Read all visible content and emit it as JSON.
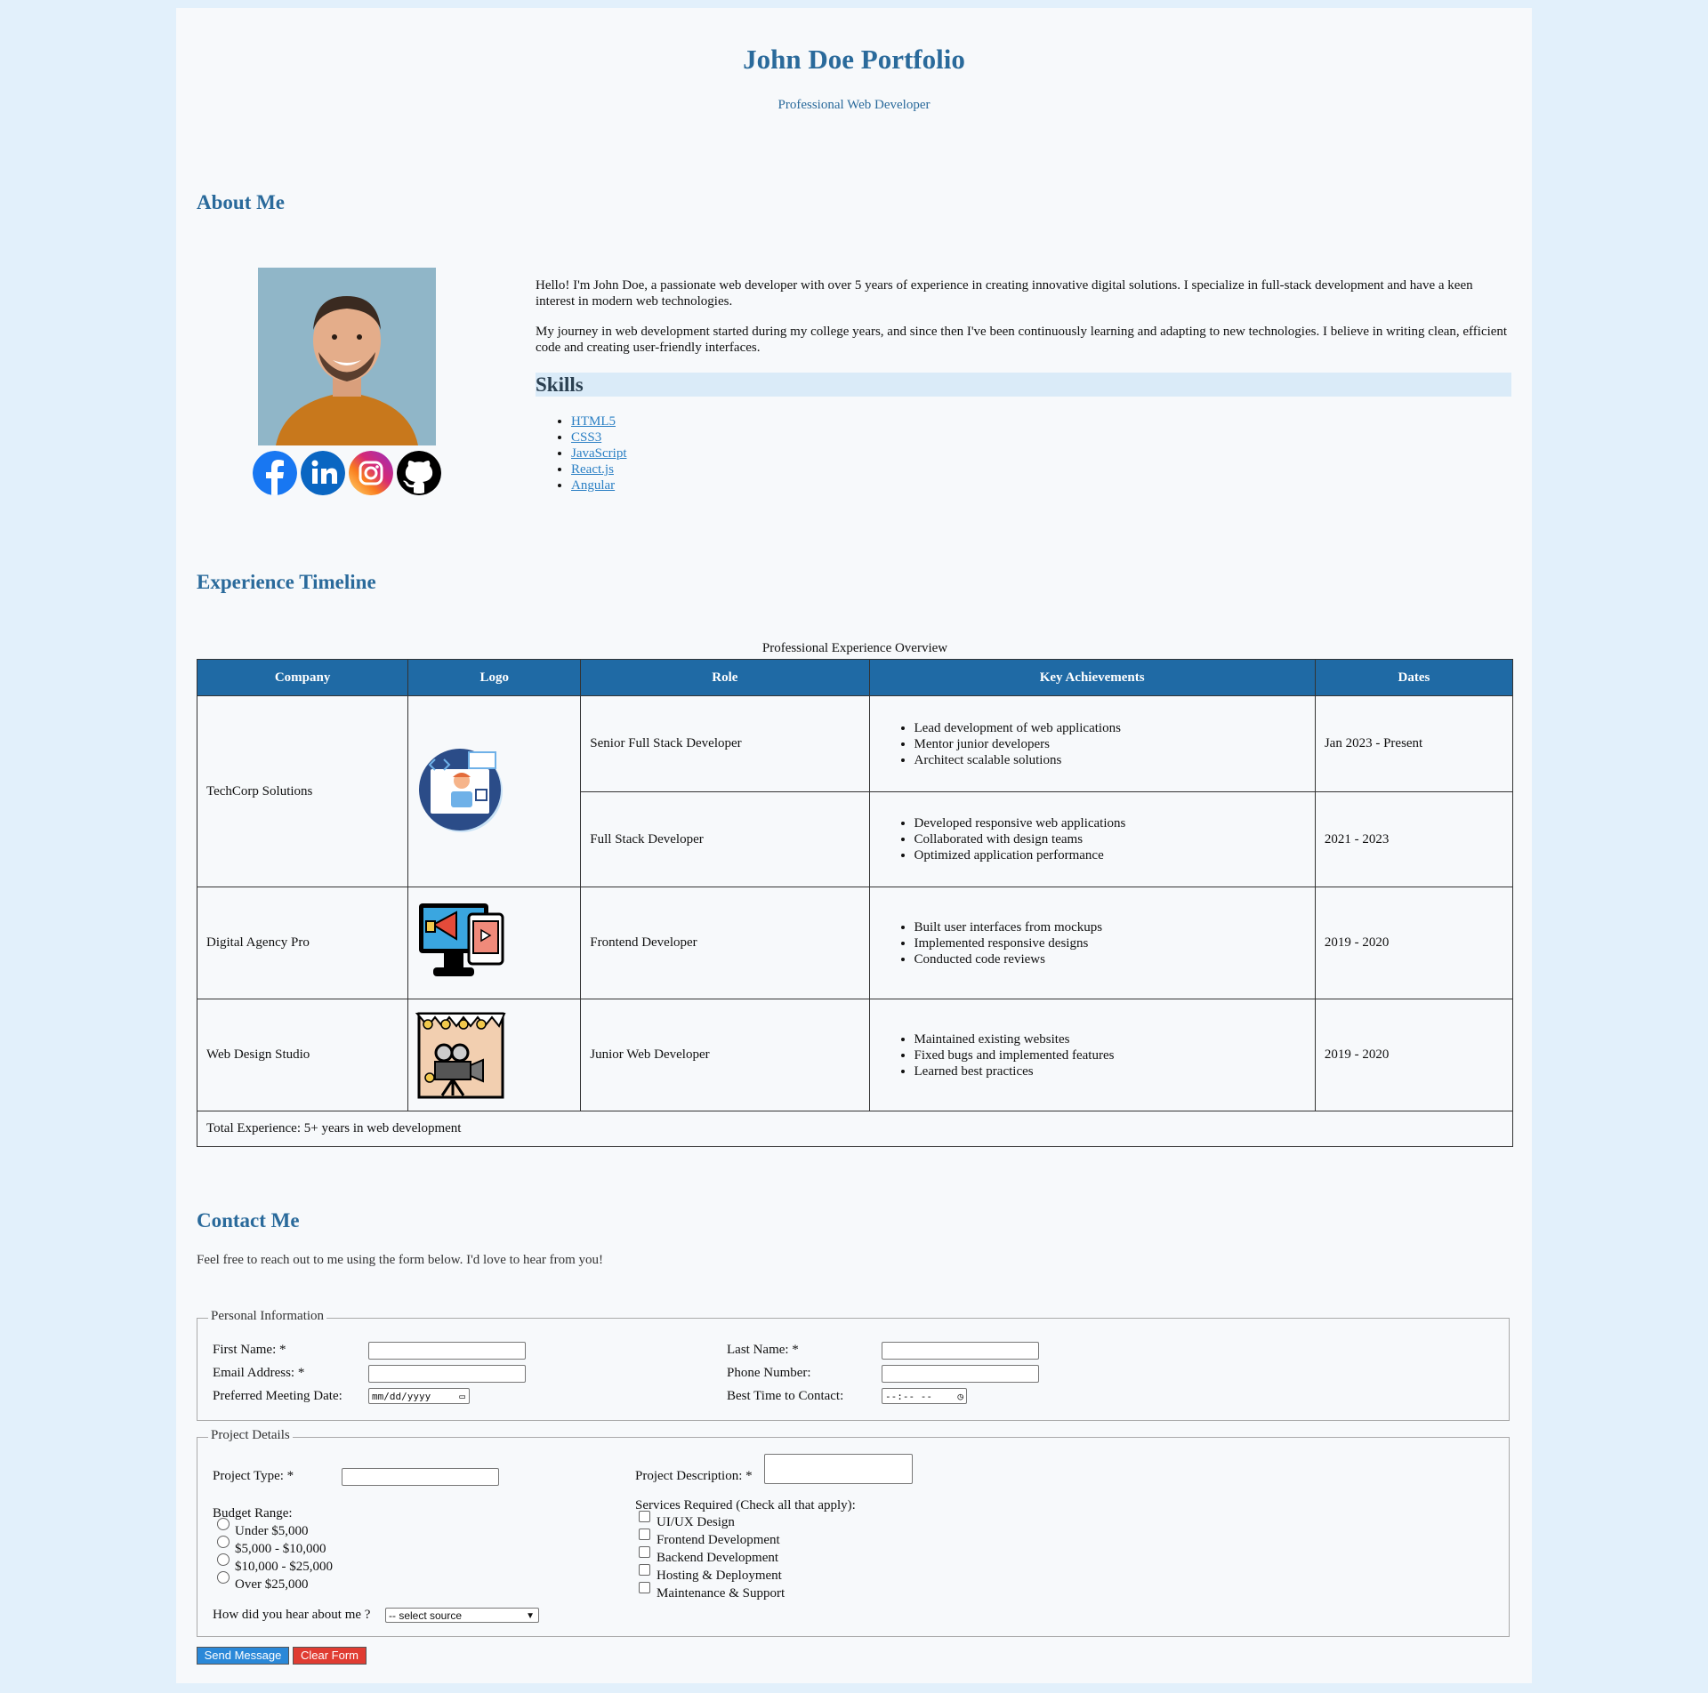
{
  "header": {
    "title": "John Doe Portfolio",
    "subtitle": "Professional Web Developer"
  },
  "about": {
    "heading": "About Me",
    "paragraph1": "Hello! I'm John Doe, a passionate web developer with over 5 years of experience in creating innovative digital solutions. I specialize in full-stack development and have a keen interest in modern web technologies.",
    "paragraph2": "My journey in web development started during my college years, and since then I've been continuously learning and adapting to new technologies. I believe in writing clean, efficient code and creating user-friendly interfaces.",
    "social": [
      "facebook-icon",
      "linkedin-icon",
      "instagram-icon",
      "github-icon"
    ]
  },
  "skills": {
    "heading": "Skills",
    "items": [
      "HTML5",
      "CSS3",
      "JavaScript",
      "React.js",
      "Angular"
    ]
  },
  "experience": {
    "heading": "Experience Timeline",
    "caption": "Professional Experience Overview",
    "columns": [
      "Company",
      "Logo",
      "Role",
      "Key Achievements",
      "Dates"
    ],
    "rows": [
      {
        "company": "TechCorp Solutions",
        "role": "Senior Full Stack Developer",
        "achievements": [
          "Lead development of web applications",
          "Mentor junior developers",
          "Architect scalable solutions"
        ],
        "dates": "Jan 2023 - Present"
      },
      {
        "company": "",
        "role": "Full Stack Developer",
        "achievements": [
          "Developed responsive web applications",
          "Collaborated with design teams",
          "Optimized application performance"
        ],
        "dates": "2021 - 2023"
      },
      {
        "company": "Digital Agency Pro",
        "role": "Frontend Developer",
        "achievements": [
          "Built user interfaces from mockups",
          "Implemented responsive designs",
          "Conducted code reviews"
        ],
        "dates": "2019 - 2020"
      },
      {
        "company": "Web Design Studio",
        "role": "Junior Web Developer",
        "achievements": [
          "Maintained existing websites",
          "Fixed bugs and implemented features",
          "Learned best practices"
        ],
        "dates": "2019 - 2020"
      }
    ],
    "footer": "Total Experience: 5+ years in web development"
  },
  "contact": {
    "heading": "Contact Me",
    "intro": "Feel free to reach out to me using the form below. I'd love to hear from you!",
    "personal_legend": "Personal Information",
    "first_name": "First Name: *",
    "last_name": "Last Name: *",
    "email": "Email Address: *",
    "phone": "Phone Number:",
    "meeting_date": "Preferred Meeting Date:",
    "date_placeholder": "mm/dd/yyyy",
    "best_time": "Best Time to Contact:",
    "time_placeholder": "--:-- --",
    "project_legend": "Project Details",
    "project_type": "Project Type: *",
    "project_description": "Project Description: *",
    "budget_label": "Budget Range:",
    "budget_options": [
      "Under $5,000",
      "$5,000 - $10,000",
      "$10,000 - $25,000",
      "Over $25,000"
    ],
    "services_label": "Services Required (Check all that apply):",
    "services": [
      "UI/UX Design",
      "Frontend Development",
      "Backend Development",
      "Hosting & Deployment",
      "Maintenance & Support"
    ],
    "source_label": "How did you hear about me ?",
    "source_selected": "-- select source",
    "send_label": "Send Message",
    "clear_label": "Clear Form"
  }
}
